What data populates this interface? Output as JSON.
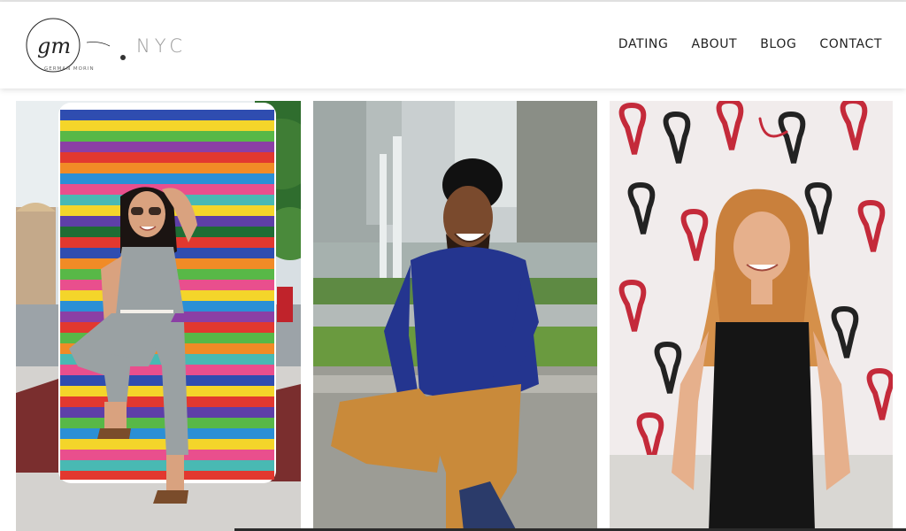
{
  "brand": {
    "monogram": "gm",
    "signature": "GERMAN MORIN",
    "city": "NYC"
  },
  "nav": {
    "items": [
      {
        "label": "DATING"
      },
      {
        "label": "ABOUT"
      },
      {
        "label": "BLOG"
      },
      {
        "label": "CONTACT"
      }
    ]
  },
  "gallery": {
    "photos": [
      {
        "subject": "woman-sunglasses-rainbow-bench"
      },
      {
        "subject": "man-blue-sweater-sitting"
      },
      {
        "subject": "woman-black-top-heart-mural"
      }
    ]
  },
  "colors": {
    "text": "#222222",
    "city_text": "#9a9a9a",
    "sweater": "#24358f",
    "pants": "#c98a3a"
  }
}
